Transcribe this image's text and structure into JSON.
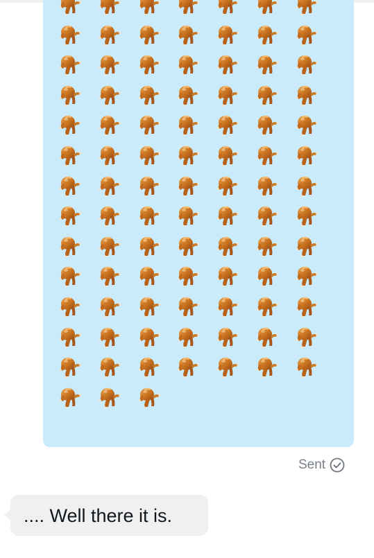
{
  "conversation": {
    "sent_message": {
      "emoji": "roasted-chicken-emoji",
      "emoji_count": 94,
      "status_label": "Sent",
      "status_icon": "check-circle-icon",
      "bubble_color": "#c9ebfb"
    },
    "received_message": {
      "text": ".... Well there it is.",
      "bubble_color": "#eef0f2"
    }
  }
}
